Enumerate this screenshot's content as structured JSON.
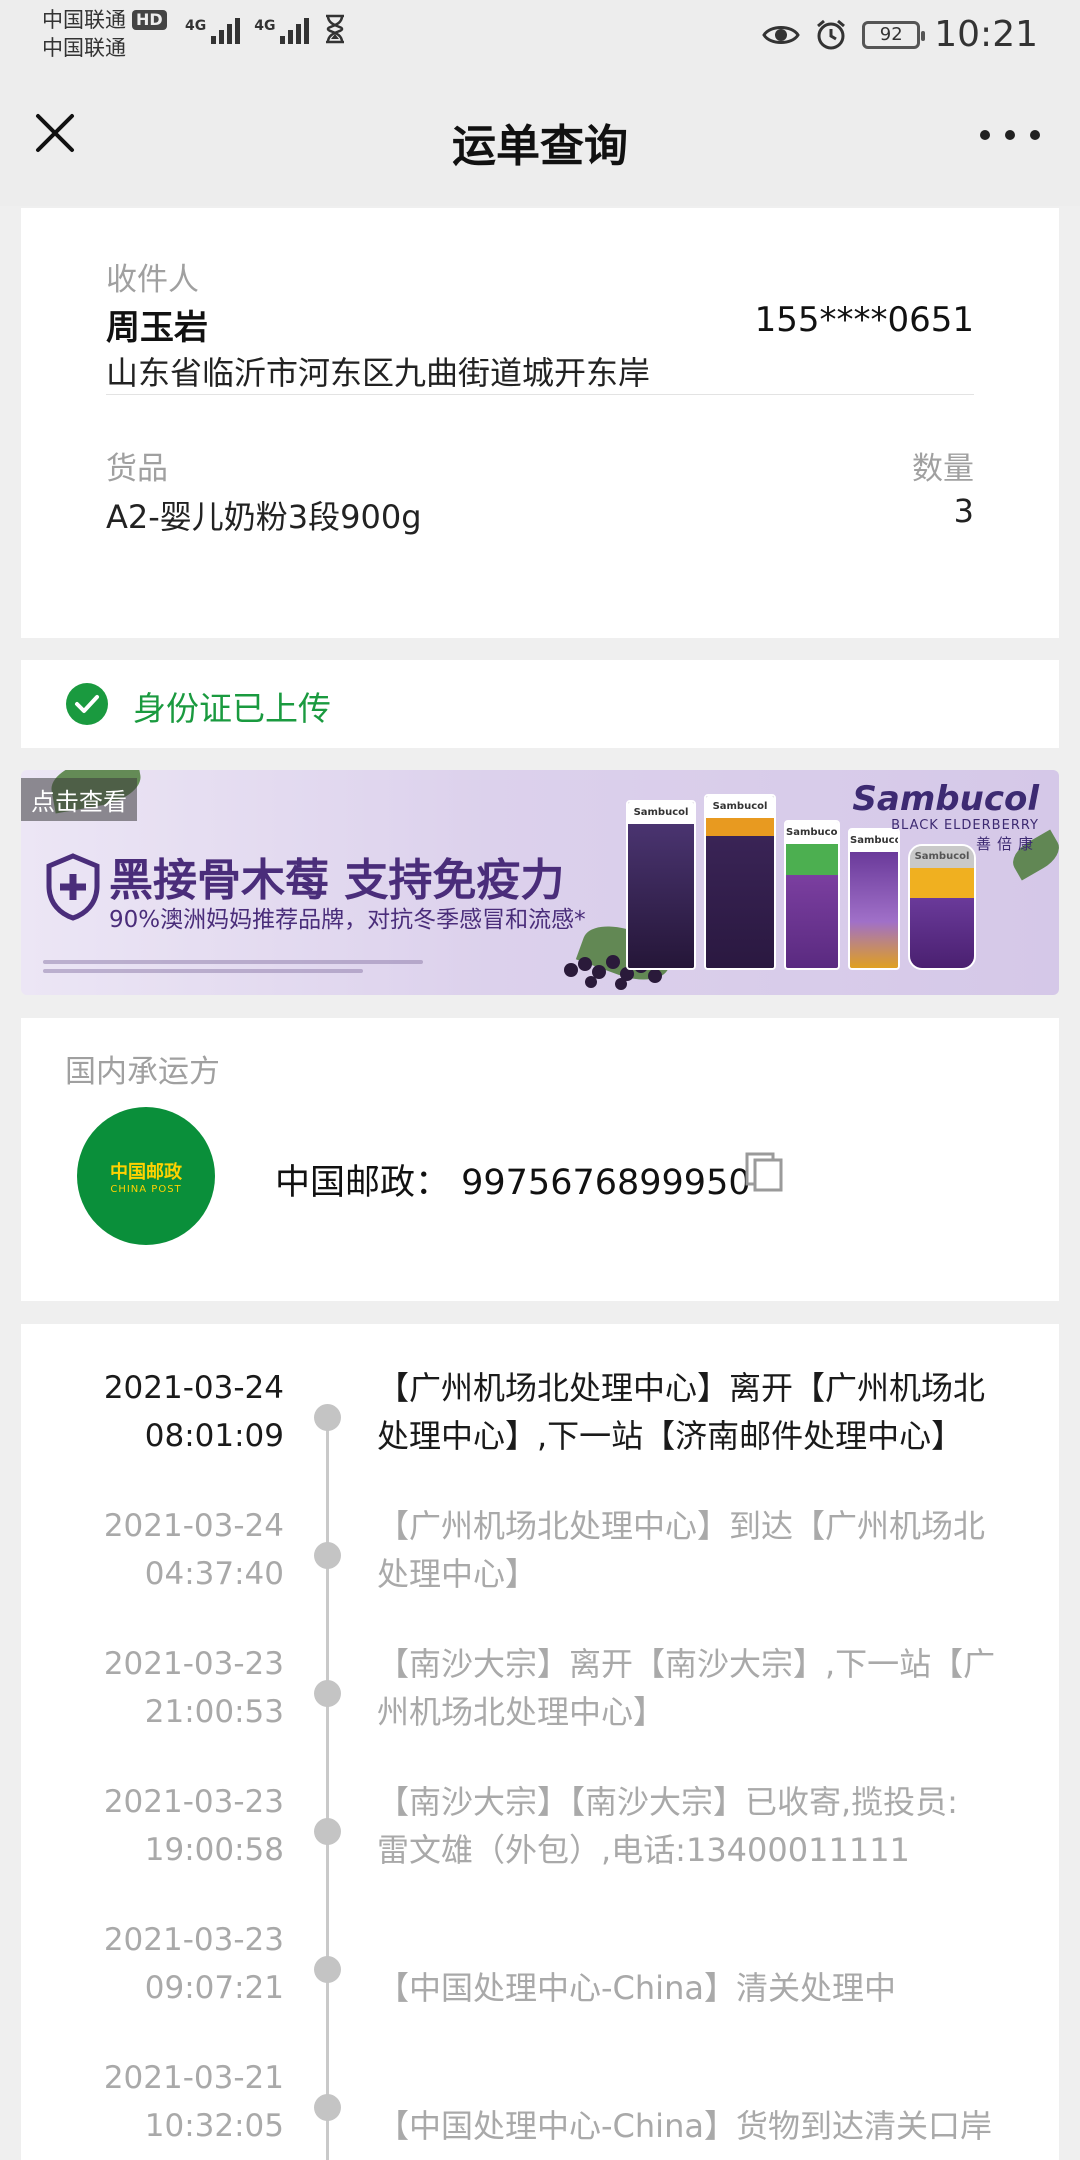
{
  "status_bar": {
    "carrier_1": "中国联通",
    "hd_badge": "HD",
    "carrier_2": "中国联通",
    "signal_1_label": "4G",
    "signal_2_label": "4G",
    "battery": "92",
    "time": "10:21"
  },
  "header": {
    "title": "运单查询"
  },
  "recipient": {
    "label": "收件人",
    "name": "周玉岩",
    "phone": "155****0651",
    "address": "山东省临沂市河东区九曲街道城开东岸"
  },
  "goods": {
    "label": "货品",
    "qty_label": "数量",
    "name": "A2-婴儿奶粉3段900g",
    "qty": "3"
  },
  "id_status": {
    "text": "身份证已上传",
    "color": "#1a9a3f"
  },
  "ad": {
    "view_tag": "点击查看",
    "headline": "黑接骨木莓 支持免疫力",
    "subline": "90%澳洲妈妈推荐品牌，对抗冬季感冒和流感*",
    "brand": "Sambucol",
    "brand_sub": "BLACK ELDERBERRY",
    "brand_cn": "善倍康",
    "products": [
      "Sambucol",
      "Sambucol",
      "Sambucol",
      "Sambucol",
      "Sambucol"
    ]
  },
  "carrier": {
    "label": "国内承运方",
    "logo_text_cn": "中国邮政",
    "logo_text_en": "CHINA POST",
    "tracking": "中国邮政： 9975676899950"
  },
  "timeline": [
    {
      "date": "2021-03-24",
      "time": "08:01:09",
      "line1": "【广州机场北处理中心】离开【广州机场北",
      "line2": "处理中心】,下一站【济南邮件处理中心】",
      "active": true
    },
    {
      "date": "2021-03-24",
      "time": "04:37:40",
      "line1": "【广州机场北处理中心】到达【广州机场北",
      "line2": "处理中心】",
      "active": false
    },
    {
      "date": "2021-03-23",
      "time": "21:00:53",
      "line1": "【南沙大宗】离开【南沙大宗】,下一站【广",
      "line2": "州机场北处理中心】",
      "active": false
    },
    {
      "date": "2021-03-23",
      "time": "19:00:58",
      "line1": "【南沙大宗】【南沙大宗】已收寄,揽投员:",
      "line2": "雷文雄（外包）,电话:13400011111",
      "active": false
    },
    {
      "date": "2021-03-23",
      "time": "09:07:21",
      "line1": "",
      "line2": "【中国处理中心-China】清关处理中",
      "active": false
    },
    {
      "date": "2021-03-21",
      "time": "10:32:05",
      "line1": "",
      "line2": "【中国处理中心-China】货物到达清关口岸",
      "active": false
    }
  ]
}
